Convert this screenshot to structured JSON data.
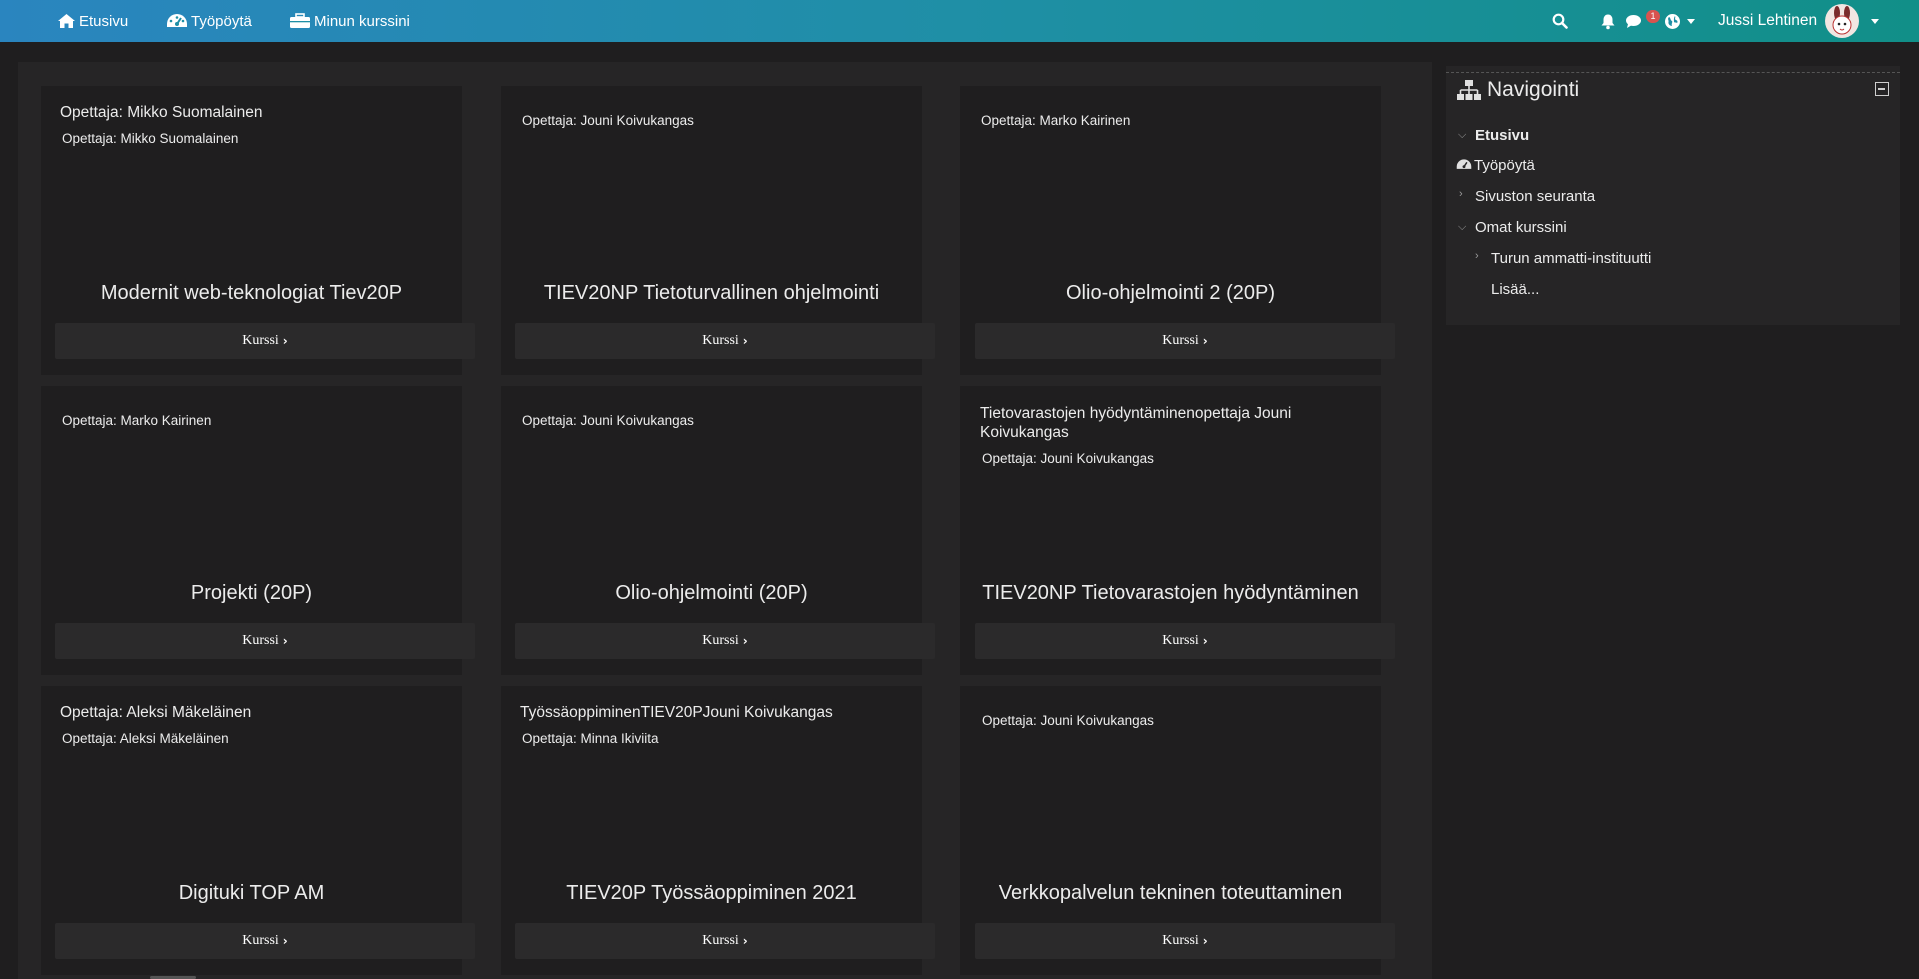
{
  "navbar": {
    "home": "Etusivu",
    "dashboard": "Työpöytä",
    "my_courses": "Minun kurssini",
    "message_count": "1",
    "user_name": "Jussi Lehtinen"
  },
  "button_label": "Kurssi",
  "courses": [
    {
      "teacher_summary": "Opettaja: Mikko Suomalainen",
      "teacher": "Opettaja: Mikko Suomalainen",
      "title": "Modernit web-teknologiat Tiev20P"
    },
    {
      "teacher_summary": "",
      "teacher": "Opettaja: Jouni Koivukangas",
      "title": "TIEV20NP Tietoturvallinen ohjelmointi"
    },
    {
      "teacher_summary": "",
      "teacher": "Opettaja: Marko Kairinen",
      "title": "Olio-ohjelmointi 2 (20P)"
    },
    {
      "teacher_summary": "",
      "teacher": "Opettaja: Marko Kairinen",
      "title": "Projekti (20P)"
    },
    {
      "teacher_summary": "",
      "teacher": "Opettaja: Jouni Koivukangas",
      "title": "Olio-ohjelmointi (20P)"
    },
    {
      "teacher_summary": "Tietovarastojen hyödyntäminenopettaja Jouni Koivukangas",
      "teacher": "Opettaja: Jouni Koivukangas",
      "title": "TIEV20NP Tietovarastojen hyödyntäminen"
    },
    {
      "teacher_summary": "Opettaja: Aleksi Mäkeläinen",
      "teacher": "Opettaja: Aleksi Mäkeläinen",
      "title": "Digituki TOP AM"
    },
    {
      "teacher_summary": "TyössäoppiminenTIEV20PJouni Koivukangas",
      "teacher": "Opettaja: Minna Ikiviita",
      "title": "TIEV20P Työssäoppiminen 2021"
    },
    {
      "teacher_summary": "",
      "teacher": "Opettaja: Jouni Koivukangas",
      "title": "Verkkopalvelun tekninen toteuttaminen"
    }
  ],
  "navigation": {
    "title": "Navigointi",
    "items": [
      "Etusivu",
      "Työpöytä",
      "Sivuston seuranta",
      "Omat kurssini",
      "Turun ammatti-instituutti",
      "Lisää..."
    ]
  }
}
